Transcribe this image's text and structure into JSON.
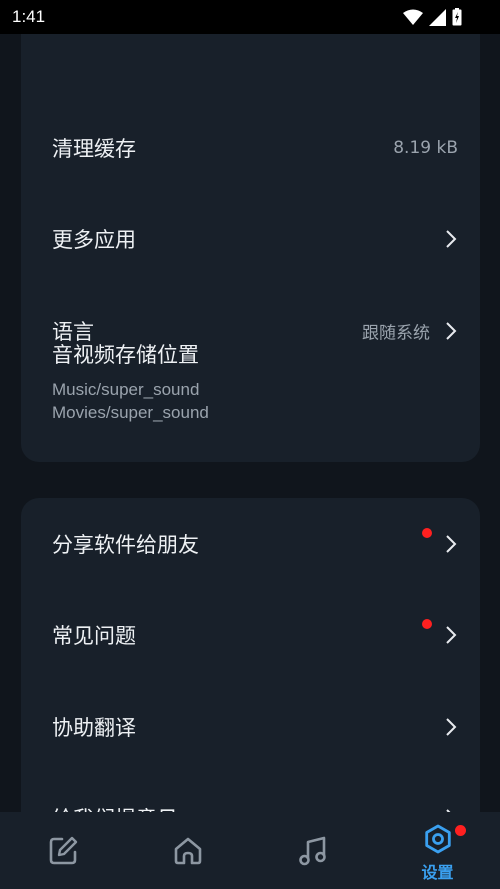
{
  "status_bar": {
    "time": "1:41"
  },
  "section1": {
    "clear_cache": {
      "label": "清理缓存",
      "value": "8.19 kB"
    },
    "more_apps": {
      "label": "更多应用"
    },
    "language": {
      "label": "语言",
      "value": "跟随系统"
    },
    "storage": {
      "label": "音视频存储位置",
      "music_path": "Music/super_sound",
      "movies_path": "Movies/super_sound"
    }
  },
  "section2": {
    "share": {
      "label": "分享软件给朋友",
      "has_badge": true
    },
    "faq": {
      "label": "常见问题",
      "has_badge": true
    },
    "translate": {
      "label": "协助翻译"
    },
    "feedback": {
      "label": "给我们提意见"
    }
  },
  "bottom_nav": {
    "items": [
      {
        "icon": "edit-icon",
        "label": ""
      },
      {
        "icon": "home-icon",
        "label": ""
      },
      {
        "icon": "music-note-icon",
        "label": ""
      },
      {
        "icon": "settings-hexagon-icon",
        "label": "设置",
        "active": true,
        "has_badge": true
      }
    ]
  },
  "colors": {
    "background": "#10151c",
    "card": "#18202a",
    "accent": "#3aa0f0",
    "badge": "#ff2020",
    "secondary_text": "#9aa3ad"
  }
}
